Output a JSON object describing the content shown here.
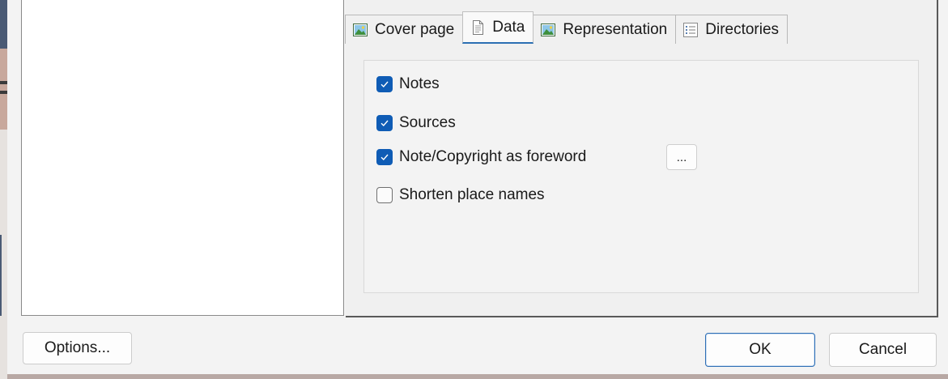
{
  "tabs": [
    {
      "label": "Cover page",
      "icon": "picture-icon"
    },
    {
      "label": "Data",
      "icon": "document-icon"
    },
    {
      "label": "Representation",
      "icon": "picture-icon"
    },
    {
      "label": "Directories",
      "icon": "list-icon"
    }
  ],
  "active_tab": "Data",
  "options": [
    {
      "label": "Notes",
      "checked": true
    },
    {
      "label": "Sources",
      "checked": true
    },
    {
      "label": "Note/Copyright as foreword",
      "checked": true
    },
    {
      "label": "Shorten place names",
      "checked": false
    }
  ],
  "foreword_settings_label": "...",
  "buttons": {
    "options": "Options...",
    "ok": "OK",
    "cancel": "Cancel"
  },
  "colors": {
    "checkbox_accent": "#0f5cb5",
    "active_tab_underline": "#2b6fb3",
    "default_button_border": "#2f6fb5"
  }
}
